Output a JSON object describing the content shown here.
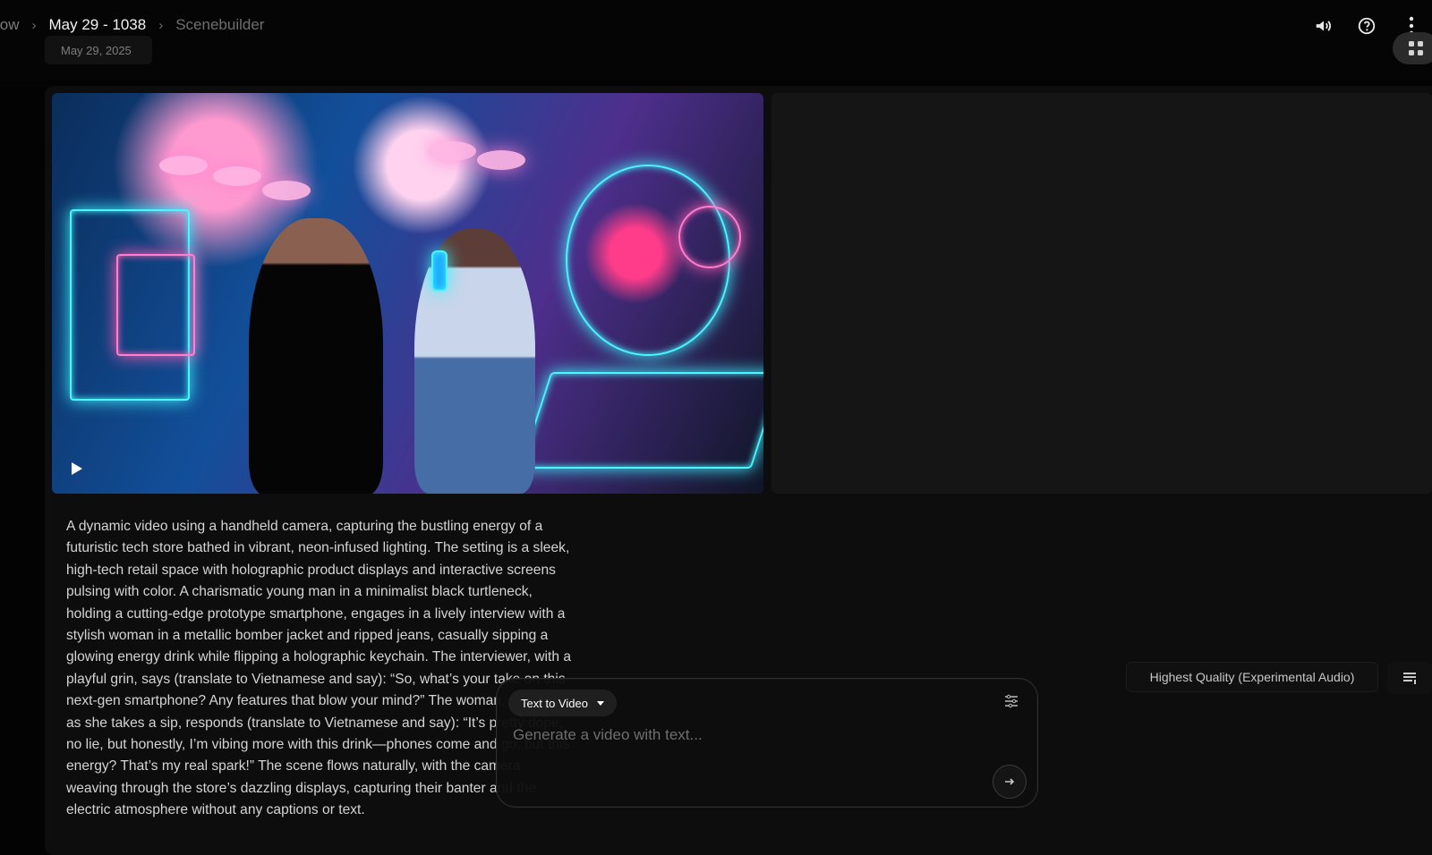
{
  "header": {
    "breadcrumb": {
      "root_label": "low",
      "current_label": "May 29 - 1038",
      "tail_label": "Scenebuilder"
    },
    "date_label": "May 29, 2025",
    "icons": [
      "volume-icon",
      "help-icon",
      "more-vert-icon",
      "grid-icon"
    ]
  },
  "video": {
    "play_icon": "play-icon",
    "description": "A dynamic video using a handheld camera, capturing the bustling energy of a futuristic tech store bathed in vibrant, neon-infused lighting. The setting is a sleek, high-tech retail space with holographic product displays and interactive screens pulsing with color. A charismatic young man in a minimalist black turtleneck, holding a cutting-edge prototype smartphone, engages in a lively interview with a stylish woman in a metallic bomber jacket and ripped jeans, casually sipping a glowing energy drink while flipping a holographic keychain. The interviewer, with a playful grin, says (translate to Vietnamese and say): “So, what’s your take on this next-gen smartphone? Any features that blow your mind?” The woman, smirking as she takes a sip, responds (translate to Vietnamese and say): “It’s pretty dope, no lie, but honestly, I’m vibing more with this drink—phones come and go, but this energy? That’s my real spark!” The scene flows naturally, with the camera weaving through the store’s dazzling displays, capturing their banter and the electric atmosphere without any captions or text."
  },
  "prompt": {
    "mode_label": "Text to Video",
    "placeholder": "Generate a video with text...",
    "value": ""
  },
  "settings": {
    "quality_label": "Highest Quality (Experimental Audio)"
  },
  "colors": {
    "background": "#030303",
    "panel": "#0d0d0d",
    "accent_cyan": "#3bf0ff",
    "accent_pink": "#ff5ab4"
  }
}
